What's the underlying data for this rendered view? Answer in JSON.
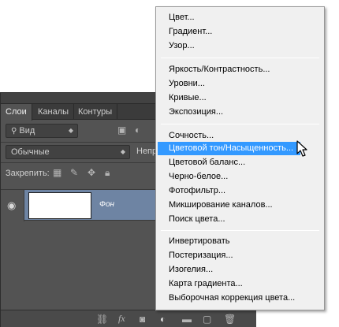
{
  "panel": {
    "tabs": [
      "Слои",
      "Каналы",
      "Контуры"
    ],
    "filter_label": "Вид",
    "blend_mode": "Обычные",
    "opacity_label_partial": "Непр",
    "lock_label": "Закрепить:",
    "layer_name": "Фон"
  },
  "menu": {
    "group1": [
      "Цвет...",
      "Градиент...",
      "Узор..."
    ],
    "group2": [
      "Яркость/Контрастность...",
      "Уровни...",
      "Кривые...",
      "Экспозиция..."
    ],
    "group3": [
      "Сочность...",
      "Цветовой тон/Насыщенность...",
      "Цветовой баланс...",
      "Черно-белое...",
      "Фотофильтр...",
      "Микширование каналов...",
      "Поиск цвета..."
    ],
    "group4": [
      "Инвертировать",
      "Постеризация...",
      "Изогелия...",
      "Карта градиента...",
      "Выборочная коррекция цвета..."
    ],
    "highlighted": "Цветовой тон/Насыщенность..."
  },
  "colors": {
    "highlight": "#3399ff",
    "panel_bg": "#535353",
    "layer_selected": "#6e84a3"
  }
}
